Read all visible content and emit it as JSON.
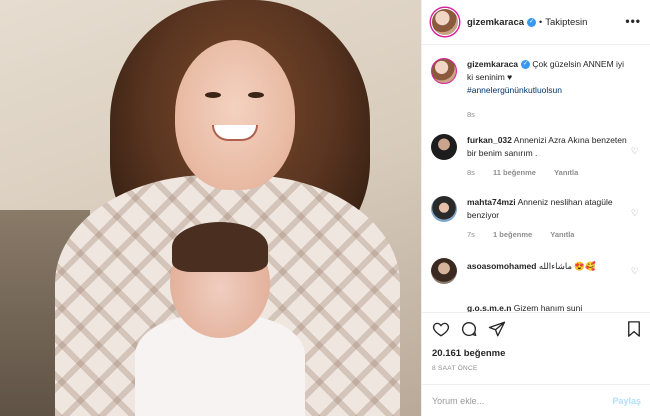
{
  "header": {
    "username": "gizemkaraca",
    "dot": "•",
    "follow_label": "Takiptesin",
    "more": "•••"
  },
  "caption": {
    "username": "gizemkaraca",
    "text": "Çok güzelsin ANNEM iyi ki seninim ♥",
    "hashtag": "#annelergününkutluolsun",
    "time": "8s"
  },
  "comments": [
    {
      "username": "furkan_032",
      "text": "Annenizi Azra Akına benzeten bir benim sanırım .",
      "time": "8s",
      "likes": "11 beğenme",
      "reply": "Yanıtla"
    },
    {
      "username": "mahta74mzi",
      "text": "Anneniz neslihan atagüle benziyor",
      "time": "7s",
      "likes": "1 beğenme",
      "reply": "Yanıtla"
    },
    {
      "username": "asoasomohamed",
      "text": "ماشاءالله 😍🥰",
      "time": "",
      "likes": "",
      "reply": ""
    },
    {
      "username": "g.o.s.m.e.n",
      "text": "Gizem hanım suni",
      "time": "",
      "likes": "",
      "reply": ""
    }
  ],
  "actions": {
    "likes": "20.161 beğenme",
    "ago": "8 SAAT ÖNCE"
  },
  "add_comment": {
    "placeholder": "Yorum ekle...",
    "share": "Paylaş"
  },
  "colors": {
    "verified": "#3897f0",
    "hashtag": "#003569",
    "share_disabled": "#b2dffc"
  }
}
